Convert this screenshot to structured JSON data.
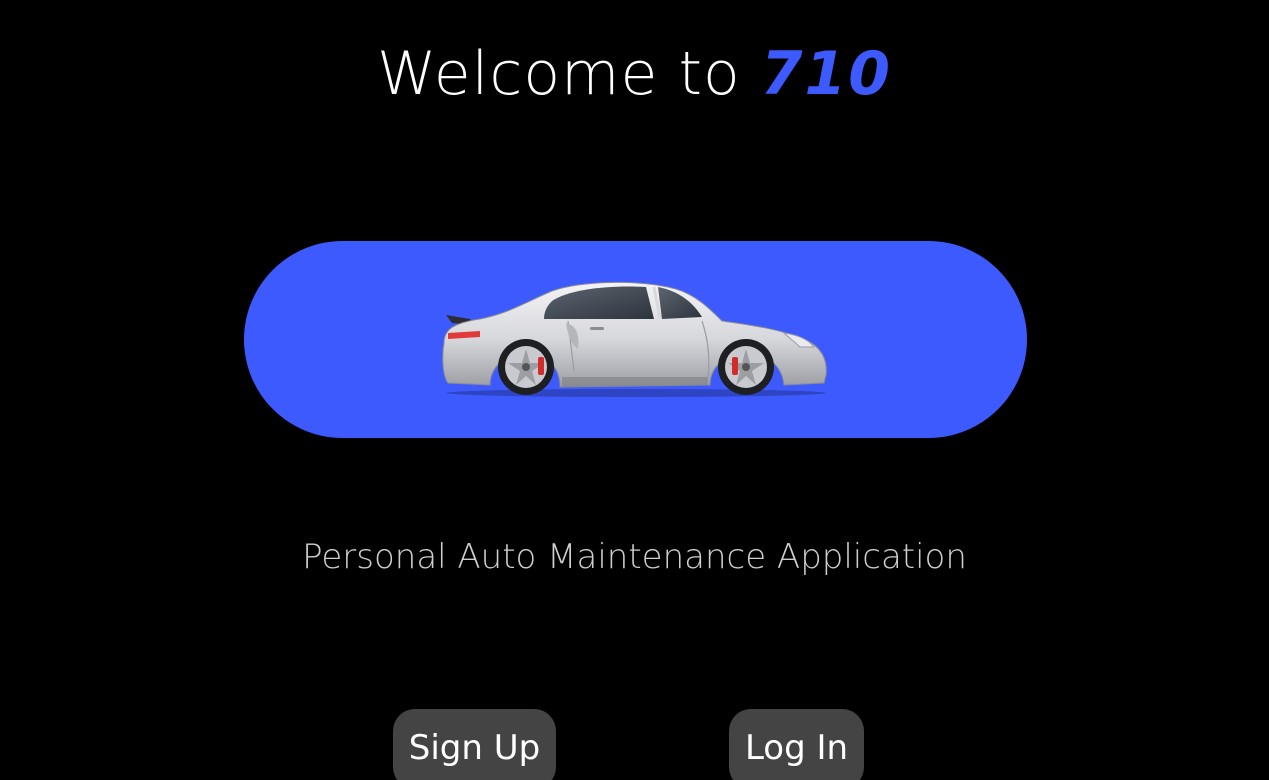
{
  "header": {
    "title_prefix": "Welcome to ",
    "title_brand": "710"
  },
  "hero": {
    "image": "sports-car-illustration",
    "background_color": "#3d5afe"
  },
  "tagline": "Personal Auto Maintenance Application",
  "actions": {
    "signup_label": "Sign Up",
    "login_label": "Log In"
  },
  "colors": {
    "background": "#000000",
    "accent": "#3d5afe",
    "button": "#444444"
  }
}
